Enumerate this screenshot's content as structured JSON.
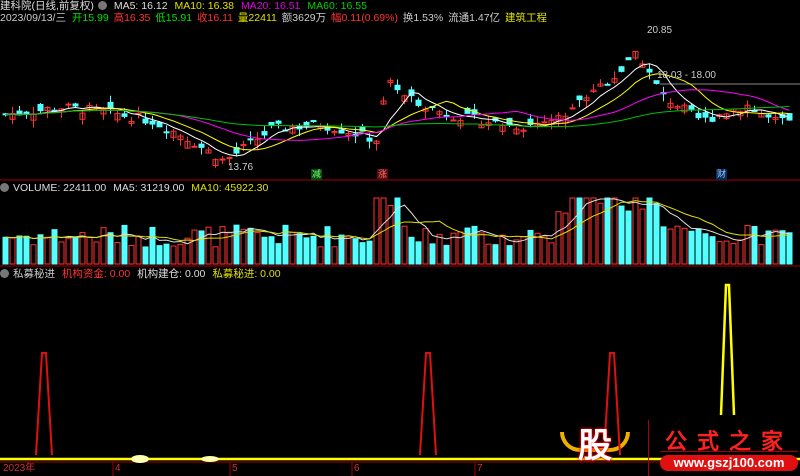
{
  "header": {
    "stock_name": "建科院(日线,前复权)",
    "ma5": "MA5: 16.12",
    "ma10": "MA10: 16.38",
    "ma20": "MA20: 16.51",
    "ma60": "MA60: 16.55",
    "date": "2023/09/13/三",
    "open": "开15.99",
    "high": "高16.35",
    "low": "低15.91",
    "close": "收16.11",
    "volume": "量22411",
    "amount": "额3629万",
    "change": "幅0.11(0.69%)",
    "turnover": "换1.53%",
    "float": "流通1.47亿",
    "sector": "建筑工程"
  },
  "price_panel": {
    "high_label": "20.85",
    "low_label": "13.76",
    "range_label": "18.03 - 18.00",
    "markers": [
      "减",
      "涨",
      "财"
    ]
  },
  "volume_panel": {
    "title": "VOLUME: 22411.00",
    "ma5": "MA5: 31219.00",
    "ma10": "MA10: 45922.30"
  },
  "indicator_panel": {
    "name": "私募秘进",
    "fund": "机构资金: 0.00",
    "build": "机构建仓: 0.00",
    "secret": "私募秘进: 0.00"
  },
  "axis": {
    "labels": [
      "2023年",
      "4",
      "5",
      "6",
      "7"
    ]
  },
  "watermark": {
    "logo_char": "股",
    "title": "公式之家",
    "url": "www.gszj100.com"
  },
  "colors": {
    "up": "#ff3232",
    "down": "#54ffff",
    "ma5": "#ffffff",
    "ma10": "#ffff00",
    "ma20": "#ff00ff",
    "ma60": "#00c000"
  }
}
